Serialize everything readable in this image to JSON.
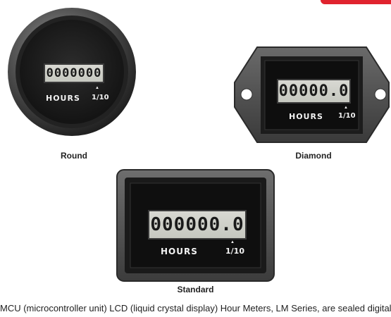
{
  "meters": [
    {
      "id": "round",
      "caption": "Round",
      "display": "0000000",
      "hours": "HOURS",
      "tenth": "1/10",
      "arrow": "▲"
    },
    {
      "id": "diamond",
      "caption": "Diamond",
      "display": "00000.0",
      "hours": "HOURS",
      "tenth": "1/10",
      "arrow": "▲"
    },
    {
      "id": "standard",
      "caption": "Standard",
      "display": "000000.0",
      "hours": "HOURS",
      "tenth": "1/10",
      "arrow": "▲"
    }
  ],
  "description": "MCU (microcontroller unit) LCD (liquid crystal display) Hour Meters, LM Series, are sealed digital",
  "colors": {
    "accent": "#e0232e",
    "bezel": "#2a2a2a",
    "face": "#1b1b1b"
  }
}
